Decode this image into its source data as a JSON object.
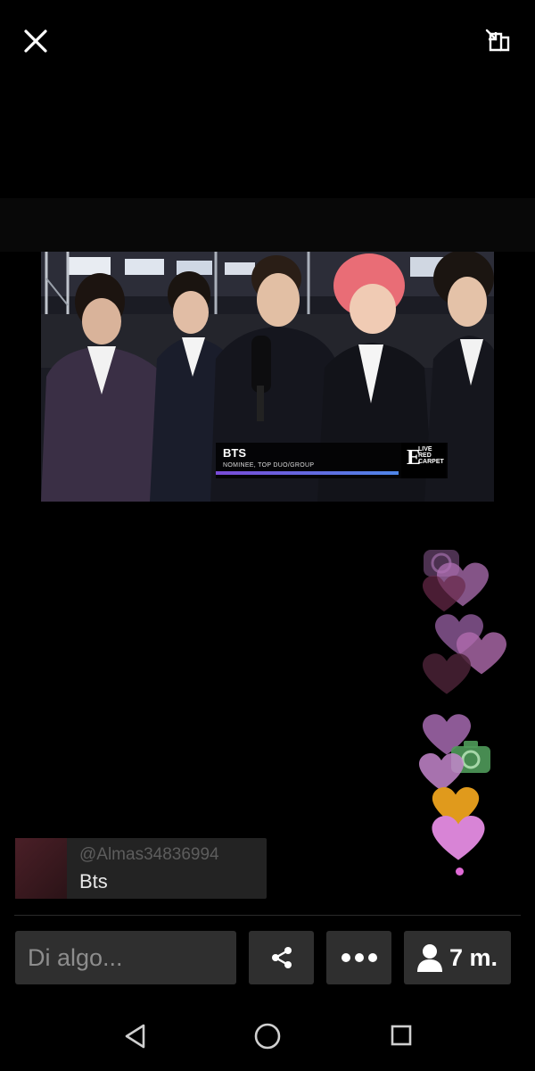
{
  "video": {
    "caption_title": "BTS",
    "caption_subtitle": "NOMINEE, TOP DUO/GROUP",
    "badge_logo": "E",
    "badge_lines": [
      "LIVE",
      "RED",
      "CARPET"
    ]
  },
  "comment": {
    "username": "@Almas34836994",
    "text": "Bts"
  },
  "actions": {
    "input_placeholder": "Di algo...",
    "viewers_count": "7 m."
  },
  "icons": {
    "close": "close-icon",
    "popout": "picture-in-picture-icon",
    "share": "share-icon",
    "more": "more-dots-icon",
    "viewers": "person-icon",
    "nav_back": "back-triangle-icon",
    "nav_home": "home-circle-icon",
    "nav_recent": "recent-square-icon"
  },
  "colors": {
    "heart_pink": "#d884d6",
    "heart_gold": "#e09a1c",
    "accent_purple": "#7a4bd8"
  }
}
